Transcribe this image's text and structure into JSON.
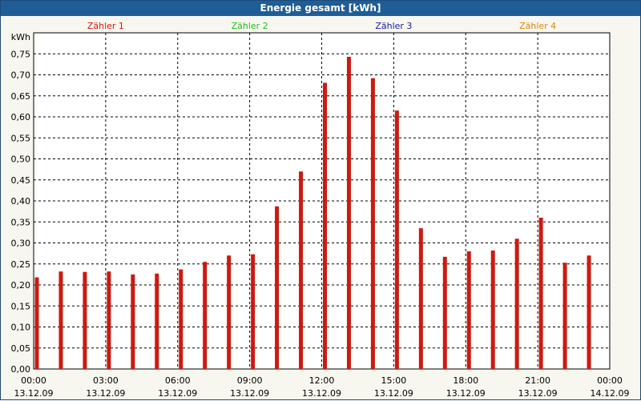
{
  "title": "Energie gesamt [kWh]",
  "chart_data": {
    "type": "bar",
    "title": "Energie gesamt [kWh]",
    "ylabel": "kWh",
    "xlabel": "",
    "ylim": [
      0,
      0.8
    ],
    "grid": true,
    "legend_placement": "top",
    "series": [
      {
        "name": "Zähler 1",
        "color": "#cc1a10",
        "values": [
          0.218,
          0.232,
          0.231,
          0.232,
          0.225,
          0.227,
          0.237,
          0.255,
          0.27,
          0.273,
          0.387,
          0.47,
          0.681,
          0.743,
          0.692,
          0.615,
          0.335,
          0.267,
          0.28,
          0.282,
          0.31,
          0.36,
          0.253,
          0.27
        ]
      }
    ],
    "legend_entries": [
      {
        "name": "Zähler 1",
        "color": "#cc1a10"
      },
      {
        "name": "Zähler 2",
        "color": "#1fbf1f"
      },
      {
        "name": "Zähler 3",
        "color": "#1a1aa6"
      },
      {
        "name": "Zähler 4",
        "color": "#d38a10"
      }
    ],
    "y_ticks": [
      "0,00",
      "0,05",
      "0,10",
      "0,15",
      "0,20",
      "0,25",
      "0,30",
      "0,35",
      "0,40",
      "0,45",
      "0,50",
      "0,55",
      "0,60",
      "0,65",
      "0,70",
      "0,75"
    ],
    "x_ticks": [
      {
        "time": "00:00",
        "date": "13.12.09"
      },
      {
        "time": "03:00",
        "date": "13.12.09"
      },
      {
        "time": "06:00",
        "date": "13.12.09"
      },
      {
        "time": "09:00",
        "date": "13.12.09"
      },
      {
        "time": "12:00",
        "date": "13.12.09"
      },
      {
        "time": "15:00",
        "date": "13.12.09"
      },
      {
        "time": "18:00",
        "date": "13.12.09"
      },
      {
        "time": "21:00",
        "date": "13.12.09"
      },
      {
        "time": "00:00",
        "date": "14.12.09"
      }
    ]
  }
}
